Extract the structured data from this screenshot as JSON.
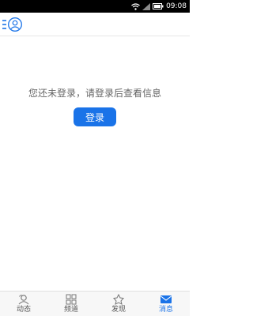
{
  "status_bar": {
    "time": "09:08",
    "icons": [
      "wifi-icon",
      "signal-icon",
      "battery-icon"
    ]
  },
  "header": {
    "menu_icon": "menu-icon",
    "user_icon": "user-icon"
  },
  "main": {
    "message": "您还未登录，请登录后查看信息",
    "login_label": "登录"
  },
  "tabs": [
    {
      "label": "动态",
      "icon": "feed-icon",
      "active": false
    },
    {
      "label": "频道",
      "icon": "channel-grid-icon",
      "active": false
    },
    {
      "label": "发现",
      "icon": "discover-icon",
      "active": false
    },
    {
      "label": "消息",
      "icon": "message-icon",
      "active": true
    }
  ],
  "colors": {
    "accent": "#1a73e8",
    "status_bar": "#000000",
    "tab_bar": "#f7f7f7",
    "text_muted": "#666666"
  }
}
